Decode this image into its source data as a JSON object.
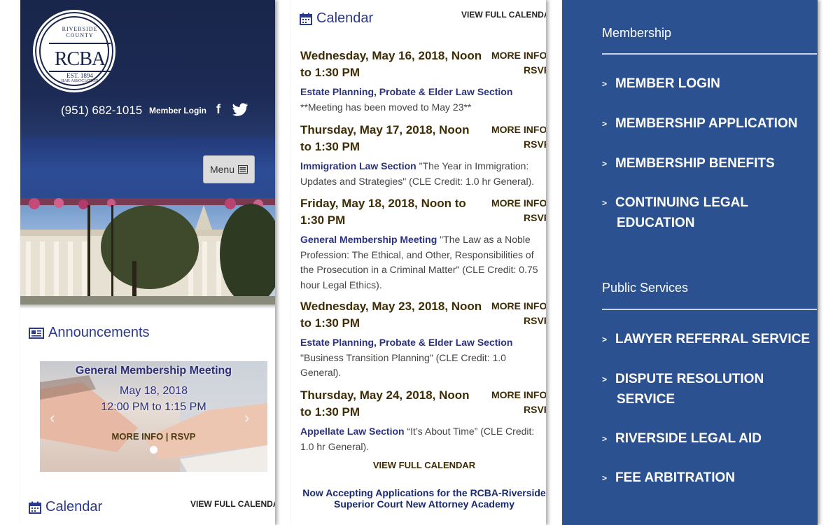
{
  "panel1": {
    "logo": {
      "arc_text": "RIVERSIDE COUNTY",
      "initials": "RCBA",
      "est": "EST. 1894",
      "bottom_arc": "BAR ASSOCIATION"
    },
    "header": {
      "phone": "(951) 682-1015",
      "member_login": "Member Login",
      "facebook_icon": "f"
    },
    "menu_label": "Menu",
    "announcements_title": "Announcements",
    "slide": {
      "title": "General Membership Meeting",
      "date": "May 18, 2018",
      "time": "12:00 PM to 1:15 PM",
      "more": "MORE INFO | RSVP",
      "prev": "‹",
      "next": "›"
    },
    "calendar_title": "Calendar",
    "view_full_calendar": "VIEW FULL CALENDAR"
  },
  "panel2": {
    "calendar_title": "Calendar",
    "view_full_calendar": "VIEW FULL CALENDAR",
    "more_info": "MORE INFO",
    "rsvp": "RSVP",
    "events": [
      {
        "date": "Wednesday, May 16, 2018, Noon to 1:30 PM",
        "section": "Estate Planning, Probate & Elder Law Section",
        "desc": " **Meeting has been moved to May 23**"
      },
      {
        "date": "Thursday, May 17, 2018, Noon to 1:30 PM",
        "section": "Immigration Law Section",
        "desc": " \"The Year in Immigration: Updates and Strategies\" (CLE Credit: 1.0 hr General)."
      },
      {
        "date": "Friday, May 18, 2018, Noon to 1:30 PM",
        "section": "General Membership Meeting",
        "desc": " \"The Law as a Noble Profession: The Ethical, and Other, Responsibilities of the Prosecution in a Criminal Matter\" (CLE Credit: 0.75 hour Legal Ethics)."
      },
      {
        "date": "Wednesday, May 23, 2018, Noon to 1:30 PM",
        "section": "Estate Planning, Probate & Elder Law Section",
        "desc": " \"Business Transition Planning\" (CLE Credit: 1.0 General)."
      },
      {
        "date": "Thursday, May 24, 2018, Noon to 1:30 PM",
        "section": "Appellate Law Section",
        "desc": " “It’s About Time” (CLE Credit: 1.0 hr General)."
      }
    ],
    "view_full_calendar_bottom": "VIEW FULL CALENDAR",
    "accepting_line1": "Now Accepting Applications for the RCBA-Riverside",
    "accepting_line2": "Superior Court New Attorney Academy"
  },
  "panel3": {
    "arrow": ">",
    "membership_heading": "Membership",
    "membership_items": [
      {
        "l1": "MEMBER LOGIN",
        "l2": ""
      },
      {
        "l1": "MEMBERSHIP APPLICATION",
        "l2": ""
      },
      {
        "l1": "MEMBERSHIP BENEFITS",
        "l2": ""
      },
      {
        "l1": "CONTINUING LEGAL",
        "l2": "EDUCATION"
      }
    ],
    "public_heading": "Public Services",
    "public_items": [
      {
        "l1": "LAWYER REFERRAL SERVICE",
        "l2": ""
      },
      {
        "l1": "DISPUTE RESOLUTION",
        "l2": "SERVICE"
      },
      {
        "l1": "RIVERSIDE LEGAL AID",
        "l2": ""
      },
      {
        "l1": "FEE ARBITRATION",
        "l2": ""
      }
    ]
  },
  "colors": {
    "header_navy": "#19254a",
    "menu_blue": "#2b4a8f",
    "nav_panel_blue": "#2b5191",
    "heading_blue": "#2c3a8c",
    "date_brown": "#3e2c05"
  }
}
